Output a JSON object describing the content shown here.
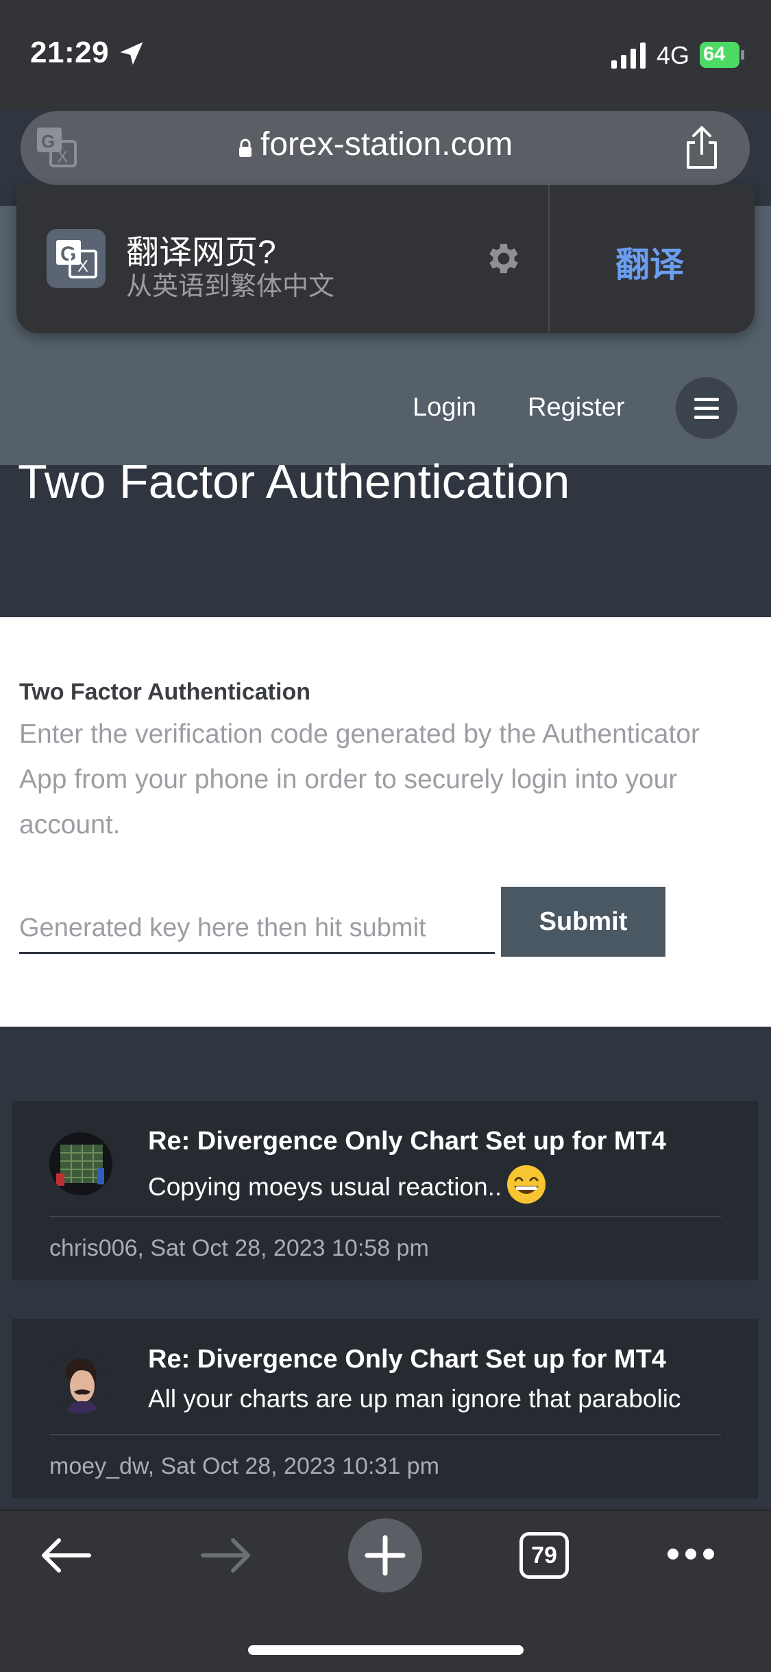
{
  "status_bar": {
    "time": "21:29",
    "network": "4G",
    "battery": "64"
  },
  "browser": {
    "url": "forex-station.com",
    "tab_count": "79"
  },
  "translate_popup": {
    "title": "翻译网页?",
    "subtitle": "从英语到繁体中文",
    "action": "翻译"
  },
  "nav": {
    "login": "Login",
    "register": "Register"
  },
  "page": {
    "title": "Two Factor Authentication"
  },
  "two_factor": {
    "heading": "Two Factor Authentication",
    "description": "Enter the verification code generated by the Authenticator App from your phone in order to securely login into your account.",
    "input_placeholder": "Generated key here then hit submit",
    "submit_label": "Submit"
  },
  "posts": [
    {
      "title": "Re: Divergence Only Chart Set up for MT4",
      "text": "Copying moeys usual reaction..",
      "meta": "chris006, Sat Oct 28, 2023 10:58 pm",
      "avatar": "chart-avatar"
    },
    {
      "title": "Re: Divergence Only Chart Set up for MT4",
      "text": "All your charts are up man ignore that parabolic",
      "meta": "moey_dw, Sat Oct 28, 2023 10:31 pm",
      "avatar": "man-avatar"
    }
  ],
  "colors": {
    "accent": "#6b9df0",
    "battery": "#4cd964",
    "submit": "#4a5863"
  }
}
